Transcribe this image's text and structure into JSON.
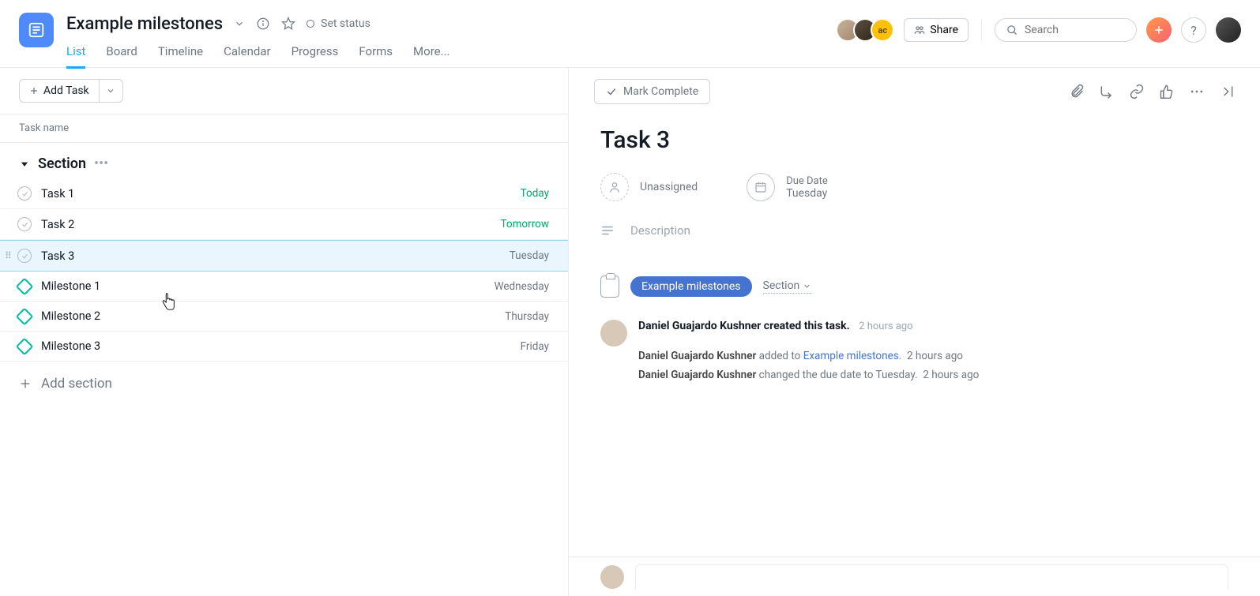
{
  "project": {
    "title": "Example milestones",
    "status_label": "Set status"
  },
  "views": {
    "list": "List",
    "board": "Board",
    "timeline": "Timeline",
    "calendar": "Calendar",
    "progress": "Progress",
    "forms": "Forms",
    "more": "More..."
  },
  "topbar": {
    "share": "Share",
    "search_placeholder": "Search",
    "avatars": [
      {
        "bg": "linear-gradient(135deg,#c9b29b,#a0876f)"
      },
      {
        "bg": "linear-gradient(135deg,#5e5143,#2e2619)"
      },
      {
        "bg": "#ffc107",
        "text": "ac"
      }
    ]
  },
  "left": {
    "add_task": "Add Task",
    "column_header": "Task name",
    "section_name": "Section",
    "add_section": "Add section",
    "tasks": [
      {
        "name": "Task 1",
        "date": "Today",
        "type": "task",
        "date_color": "green"
      },
      {
        "name": "Task 2",
        "date": "Tomorrow",
        "type": "task",
        "date_color": "green"
      },
      {
        "name": "Task 3",
        "date": "Tuesday",
        "type": "task",
        "date_color": "",
        "selected": true
      },
      {
        "name": "Milestone 1",
        "date": "Wednesday",
        "type": "milestone",
        "date_color": ""
      },
      {
        "name": "Milestone 2",
        "date": "Thursday",
        "type": "milestone",
        "date_color": ""
      },
      {
        "name": "Milestone 3",
        "date": "Friday",
        "type": "milestone",
        "date_color": ""
      }
    ]
  },
  "detail": {
    "mark_complete": "Mark Complete",
    "title": "Task 3",
    "assignee_label": "Unassigned",
    "due_label": "Due Date",
    "due_value": "Tuesday",
    "description_placeholder": "Description",
    "project_pill": "Example milestones",
    "section_select": "Section",
    "activity": {
      "author": "Daniel Guajardo Kushner",
      "headline": "Daniel Guajardo Kushner created this task.",
      "headline_time": "2 hours ago",
      "lines": [
        {
          "author": "Daniel Guajardo Kushner",
          "text": " added to ",
          "link": "Example milestones",
          "suffix": ".",
          "time": "2 hours ago"
        },
        {
          "author": "Daniel Guajardo Kushner",
          "text": " changed the due date to Tuesday.",
          "link": "",
          "suffix": "",
          "time": "2 hours ago"
        }
      ]
    }
  }
}
